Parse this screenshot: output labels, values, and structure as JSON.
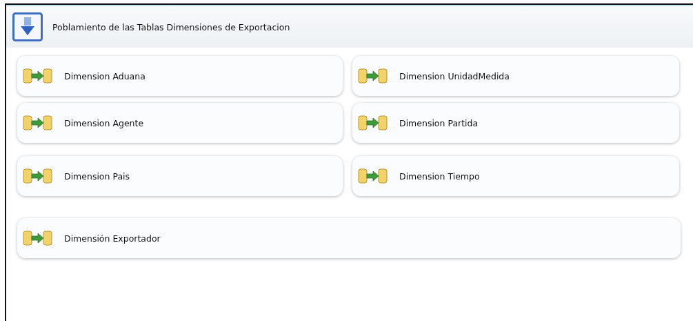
{
  "container": {
    "title": "Poblamiento de las Tablas Dimensiones de Exportacion"
  },
  "tasks": [
    {
      "label": "Dimension Aduana",
      "wide": false
    },
    {
      "label": "Dimension UnidadMedida",
      "wide": false
    },
    {
      "label": "Dimension Agente",
      "wide": false
    },
    {
      "label": "Dimension Partida",
      "wide": false
    },
    {
      "label": "Dimension Pais",
      "wide": false
    },
    {
      "label": "Dimension Tiempo",
      "wide": false
    },
    {
      "label": "Dimensión Exportador",
      "wide": true
    }
  ]
}
